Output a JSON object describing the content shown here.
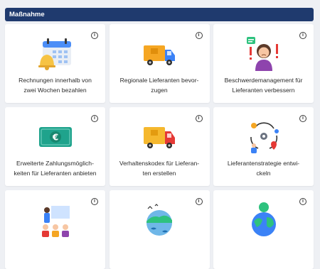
{
  "header": {
    "title": "Maßnahme"
  },
  "cards": [
    {
      "label_line1": "Rechnungen innerhalb von",
      "label_line2": "zwei Wochen bezahlen",
      "icon": "calendar-bell-icon",
      "info_glyph": "i"
    },
    {
      "label_line1": "Regionale Lieferanten bevor-",
      "label_line2": "zugen",
      "icon": "delivery-truck-icon",
      "info_glyph": "i"
    },
    {
      "label_line1": "Beschwerdemanagement für",
      "label_line2": "Lieferanten verbessern",
      "icon": "complaint-person-icon",
      "info_glyph": "i"
    },
    {
      "label_line1": "Erweiterte Zahlungsmöglich-",
      "label_line2": "keiten für Lieferanten anbieten",
      "icon": "euro-banknote-icon",
      "info_glyph": "i"
    },
    {
      "label_line1": "Verhaltenskodex für Lieferan-",
      "label_line2": "ten erstellen",
      "icon": "delivery-truck-icon",
      "info_glyph": "i"
    },
    {
      "label_line1": "Lieferantenstrategie entwi-",
      "label_line2": "ckeln",
      "icon": "strategy-cycle-icon",
      "info_glyph": "i"
    },
    {
      "label_line1": "",
      "label_line2": "",
      "icon": "presentation-team-icon",
      "info_glyph": "i"
    },
    {
      "label_line1": "",
      "label_line2": "",
      "icon": "nature-globe-icon",
      "info_glyph": "i"
    },
    {
      "label_line1": "",
      "label_line2": "",
      "icon": "earth-globe-icon",
      "info_glyph": "i"
    }
  ]
}
